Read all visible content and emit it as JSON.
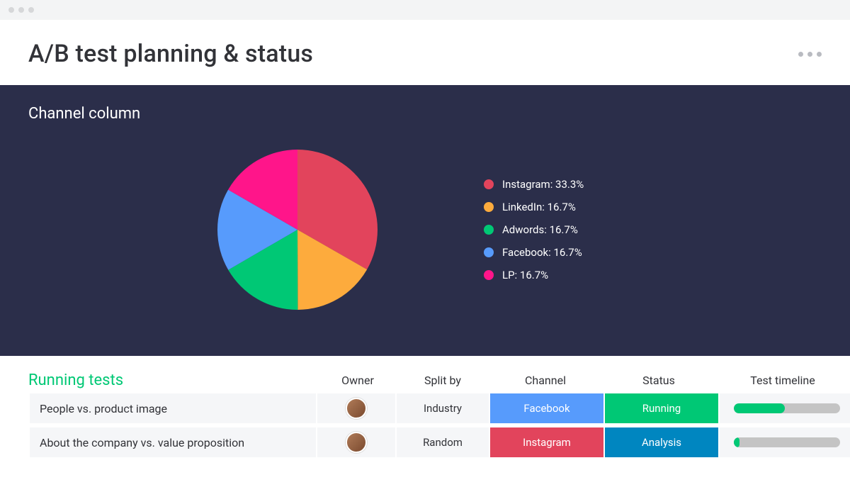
{
  "page": {
    "title": "A/B test planning & status"
  },
  "colors": {
    "instagram": "#E2445C",
    "linkedin": "#FDAB3D",
    "adwords": "#00C875",
    "facebook": "#579BFC",
    "lp": "#FF158A",
    "running": "#00C875",
    "analysis": "#0086C0",
    "accent": "#00C875",
    "panel_bg": "#2B2E4A"
  },
  "chart": {
    "title": "Channel column",
    "legend": [
      {
        "key": "instagram",
        "label": "Instagram: 33.3%"
      },
      {
        "key": "linkedin",
        "label": "LinkedIn: 16.7%"
      },
      {
        "key": "adwords",
        "label": "Adwords: 16.7%"
      },
      {
        "key": "facebook",
        "label": "Facebook: 16.7%"
      },
      {
        "key": "lp",
        "label": "LP: 16.7%"
      }
    ]
  },
  "chart_data": {
    "type": "pie",
    "title": "Channel column",
    "series": [
      {
        "name": "Instagram",
        "value": 33.3,
        "color": "#E2445C"
      },
      {
        "name": "LinkedIn",
        "value": 16.7,
        "color": "#FDAB3D"
      },
      {
        "name": "Adwords",
        "value": 16.7,
        "color": "#00C875"
      },
      {
        "name": "Facebook",
        "value": 16.7,
        "color": "#579BFC"
      },
      {
        "name": "LP",
        "value": 16.7,
        "color": "#FF158A"
      }
    ],
    "start_angle_deg": -90
  },
  "table": {
    "group_title": "Running tests",
    "columns": {
      "owner": "Owner",
      "split_by": "Split by",
      "channel": "Channel",
      "status": "Status",
      "timeline": "Test timeline"
    },
    "rows": [
      {
        "name": "People vs. product image",
        "split_by": "Industry",
        "channel_label": "Facebook",
        "channel_key": "facebook",
        "status_label": "Running",
        "status_key": "running",
        "timeline_pct": 48
      },
      {
        "name": "About the company vs. value proposition",
        "split_by": "Random",
        "channel_label": "Instagram",
        "channel_key": "instagram",
        "status_label": "Analysis",
        "status_key": "analysis",
        "timeline_pct": 5
      }
    ]
  }
}
